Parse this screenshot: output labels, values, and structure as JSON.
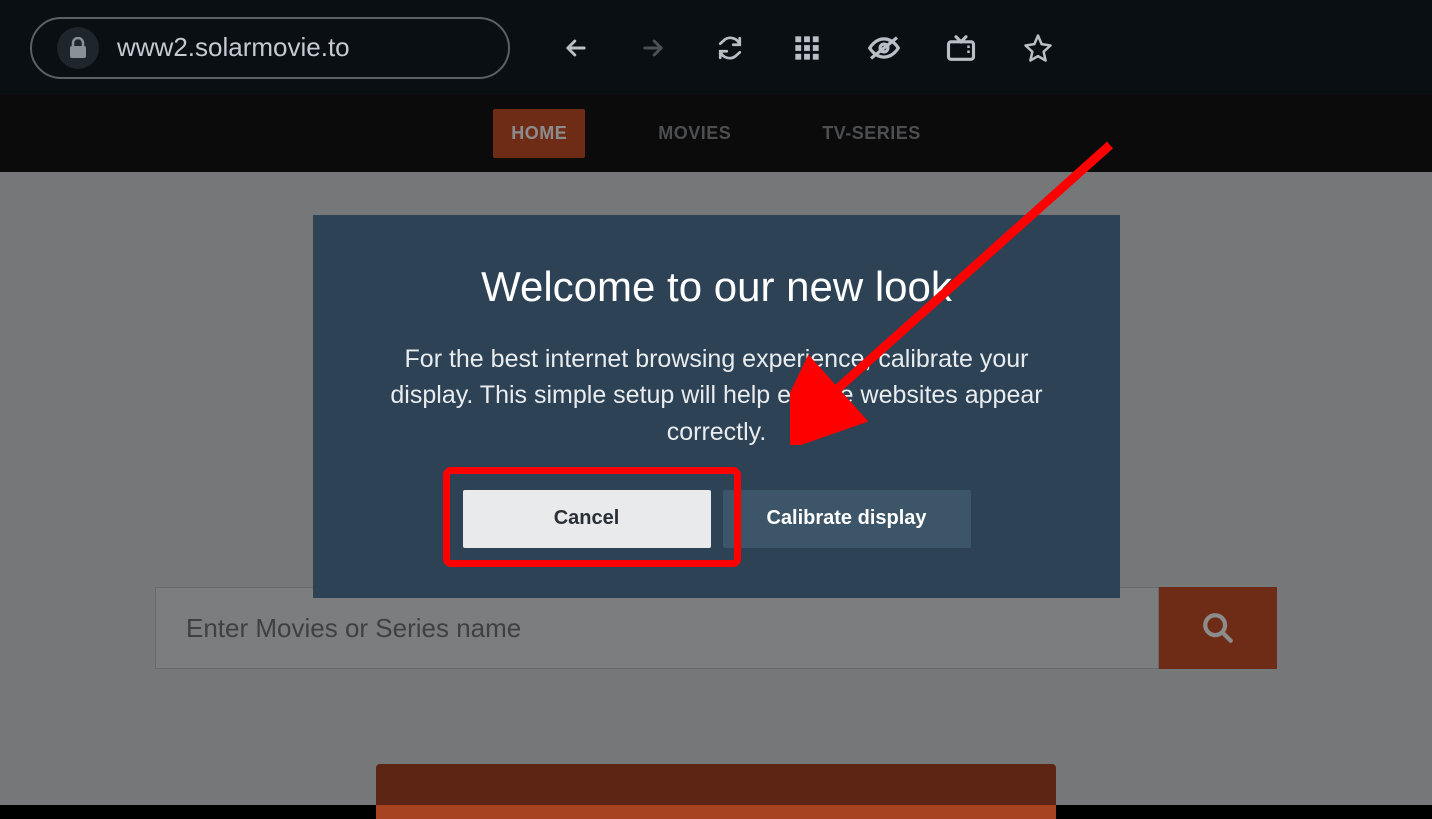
{
  "browser": {
    "url": "www2.solarmovie.to"
  },
  "nav": {
    "items": [
      {
        "label": "HOME",
        "active": true
      },
      {
        "label": "MOVIES",
        "active": false
      },
      {
        "label": "TV-SERIES",
        "active": false
      }
    ]
  },
  "search": {
    "placeholder": "Enter Movies or Series name"
  },
  "modal": {
    "title": "Welcome to our new look",
    "body": "For the best internet browsing experience, calibrate your display. This simple setup will help ensure websites appear correctly.",
    "cancel_label": "Cancel",
    "calibrate_label": "Calibrate display"
  },
  "colors": {
    "accent": "#c9502a",
    "modal_bg": "#2d4254",
    "annotation": "#ff0000"
  }
}
